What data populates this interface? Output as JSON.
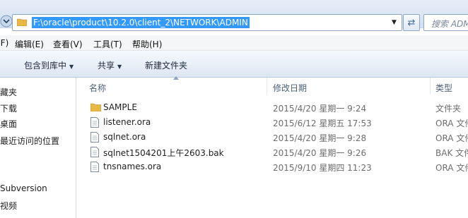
{
  "address": {
    "path": "F:\\oracle\\product\\10.2.0\\client_2\\NETWORK\\ADMIN",
    "search_placeholder": "搜索 ADM"
  },
  "menu": [
    "(F)",
    "编辑(E)",
    "查看(V)",
    "工具(T)",
    "帮助(H)"
  ],
  "toolbar": {
    "include_library": "包含到库中",
    "share": "共享",
    "new_folder": "新建文件夹"
  },
  "nav": [
    "藏夹",
    "下载",
    "桌面",
    "最近访问的位置",
    "",
    "Subversion",
    "视频"
  ],
  "columns": {
    "name": "名称",
    "date": "修改日期",
    "type": "类型"
  },
  "files": [
    {
      "name": "SAMPLE",
      "date": "2015/4/20 星期一 9:24",
      "type": "文件夹",
      "icon": "folder-icon"
    },
    {
      "name": "listener.ora",
      "date": "2015/6/12 星期五 17:53",
      "type": "ORA 文件",
      "icon": "file-icon"
    },
    {
      "name": "sqlnet.ora",
      "date": "2015/4/20 星期一 9:28",
      "type": "ORA 文件",
      "icon": "file-icon"
    },
    {
      "name": "sqlnet1504201上午2603.bak",
      "date": "2015/4/20 星期一 9:26",
      "type": "BAK 文件",
      "icon": "file-icon"
    },
    {
      "name": "tnsnames.ora",
      "date": "2015/9/10 星期四 11:23",
      "type": "ORA 文件",
      "icon": "file-icon"
    }
  ],
  "colors": {
    "selection": "#3399ff",
    "folder": "#e8b845",
    "header_text": "#4c607a"
  }
}
